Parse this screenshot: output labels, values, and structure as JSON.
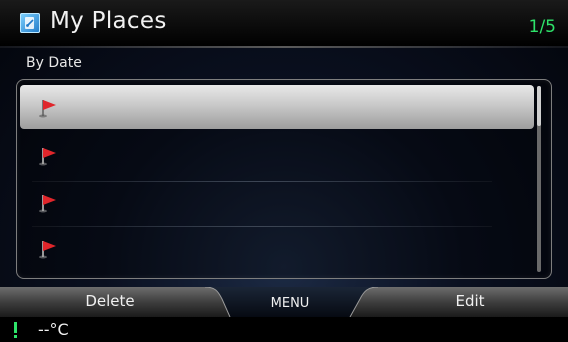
{
  "header": {
    "title": "My Places",
    "page_indicator": "1/5",
    "icon": "my-places-icon"
  },
  "subheader": {
    "label": "By Date"
  },
  "list": {
    "items": [
      {
        "icon": "flag-icon",
        "label": "",
        "selected": true
      },
      {
        "icon": "flag-icon",
        "label": "",
        "selected": false
      },
      {
        "icon": "flag-icon",
        "label": "",
        "selected": false
      },
      {
        "icon": "flag-icon",
        "label": "",
        "selected": false
      }
    ],
    "scroll_position_fraction": 0
  },
  "softkeys": {
    "delete_label": "Delete",
    "menu_label": "MENU",
    "edit_label": "Edit"
  },
  "status": {
    "warning_icon": "warning-exclamation-icon",
    "temperature": "--°C"
  },
  "colors": {
    "page_indicator": "#2ee36a",
    "flag": "#e0262b",
    "selection": "#c9c9c9"
  }
}
